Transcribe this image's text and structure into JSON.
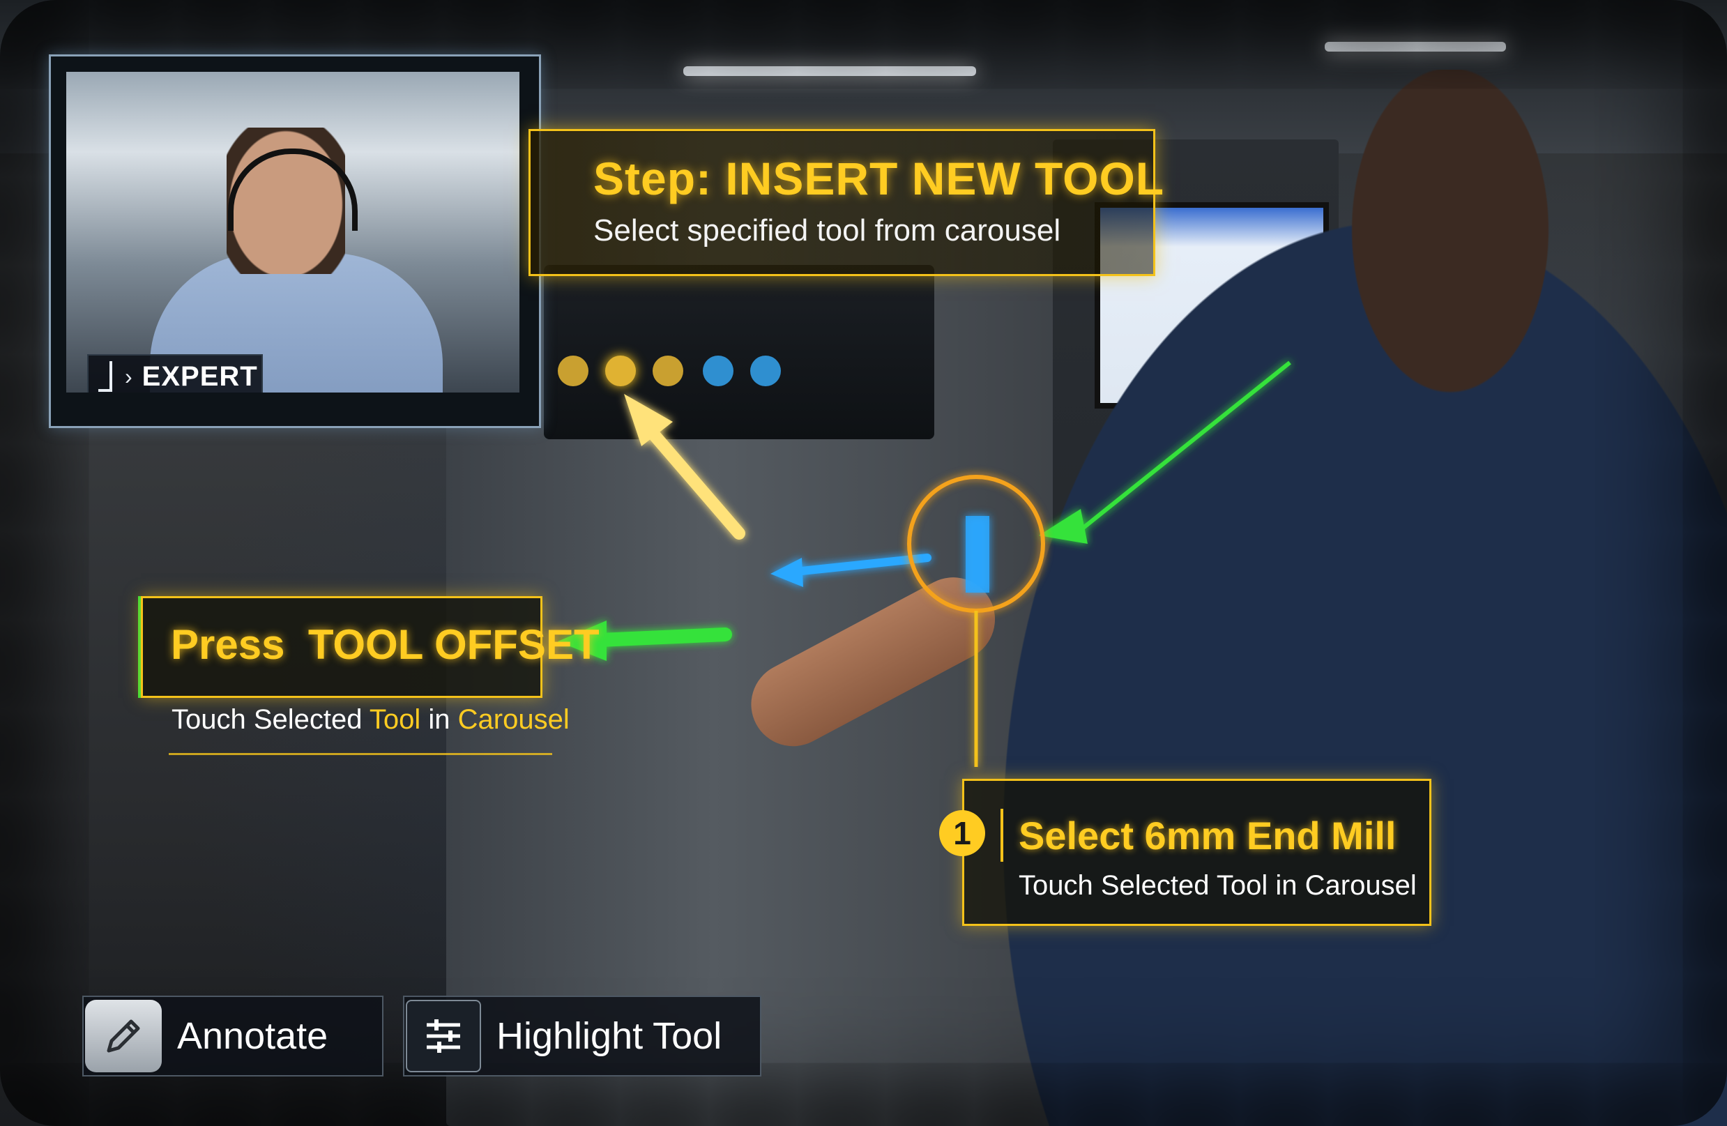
{
  "expert_panel": {
    "label": "EXPERT"
  },
  "step_banner": {
    "title": "Step: INSERT NEW TOOL",
    "subtitle": "Select specified tool from carousel"
  },
  "press_callout": {
    "label": "Press  TOOL OFFSET",
    "sub_prefix": "Touch Selected ",
    "sub_tool": "Tool",
    "sub_mid": " in ",
    "sub_carousel": "Carousel"
  },
  "step_one": {
    "number": "1",
    "title": "Select 6mm End Mill",
    "subtitle": "Touch Selected Tool in Carousel"
  },
  "toolbar": {
    "annotate_label": "Annotate",
    "annotate_icon": "pencil-icon",
    "highlight_label": "Highlight Tool",
    "highlight_icon": "sliders-icon"
  },
  "colors": {
    "accent_yellow": "#ffcc22",
    "arrow_green": "#35e23a",
    "arrow_blue": "#2aa8ff"
  }
}
